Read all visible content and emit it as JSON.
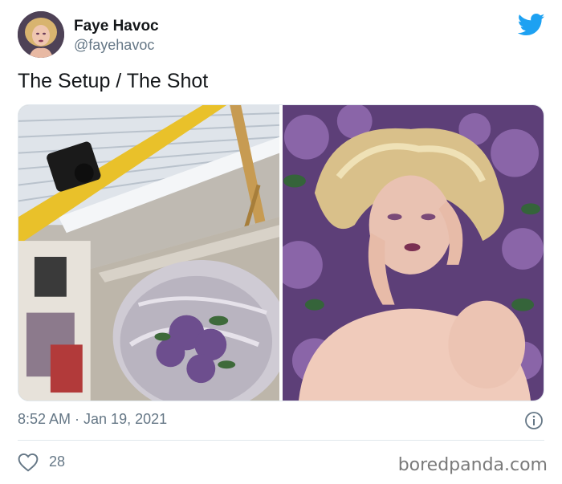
{
  "author": {
    "name": "Faye Havoc",
    "handle": "@fayehavoc"
  },
  "tweet": {
    "text": "The Setup / The Shot",
    "timestamp": "8:52 AM · Jan 19, 2021",
    "likes": "28"
  },
  "media": [
    {
      "name": "setup-photo"
    },
    {
      "name": "shot-photo"
    }
  ],
  "icons": {
    "brand": "twitter-bird-icon",
    "info": "info-icon",
    "like": "heart-icon"
  },
  "colors": {
    "twitter_blue": "#1da1f2",
    "secondary_text": "#657786"
  },
  "watermark": "boredpanda.com"
}
